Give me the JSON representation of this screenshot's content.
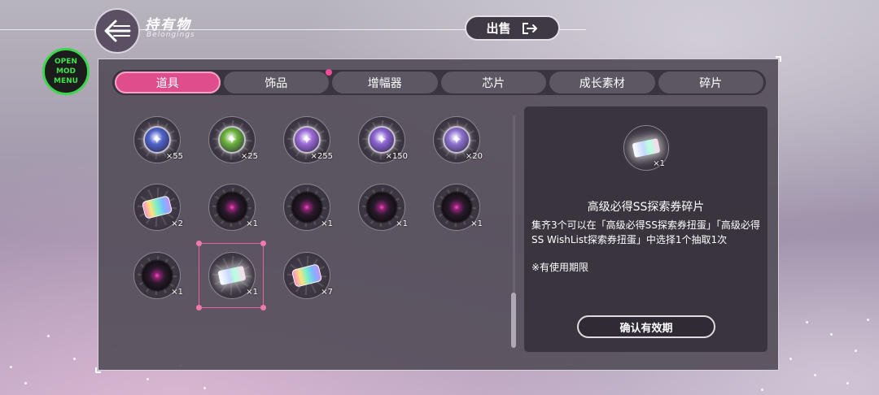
{
  "header": {
    "title": "持有物",
    "subtitle": "Belongings",
    "sell_label": "出售"
  },
  "mod_menu": {
    "line1": "OPEN",
    "line2": "MOD MENU"
  },
  "tabs": [
    {
      "label": "道具",
      "active": true
    },
    {
      "label": "饰品",
      "active": false,
      "has_notification": true
    },
    {
      "label": "增幅器",
      "active": false
    },
    {
      "label": "芯片",
      "active": false
    },
    {
      "label": "成长素材",
      "active": false
    },
    {
      "label": "碎片",
      "active": false
    }
  ],
  "items": [
    {
      "icon": "blue-gem-icon",
      "count": "×55",
      "color": "#4e63c9"
    },
    {
      "icon": "green-gem-icon",
      "count": "×25",
      "color": "#69b13a"
    },
    {
      "icon": "purple-gem-icon",
      "count": "×255",
      "color": "#9b6ad7"
    },
    {
      "icon": "violet-gem-icon",
      "count": "×150",
      "color": "#8a63d1"
    },
    {
      "icon": "lilac-gem-icon",
      "count": "×20",
      "color": "#8e72cf"
    },
    {
      "icon": "rainbow-puzzle-icon",
      "count": "×2"
    },
    {
      "icon": "shadow-orb-icon",
      "count": "×1"
    },
    {
      "icon": "shadow-orb-icon",
      "count": "×1"
    },
    {
      "icon": "shadow-orb-icon",
      "count": "×1"
    },
    {
      "icon": "shadow-orb-icon",
      "count": "×1"
    },
    {
      "icon": "shadow-orb-icon",
      "count": "×1"
    },
    {
      "icon": "ticket-fragment-icon",
      "count": "×1",
      "selected": true
    },
    {
      "icon": "rainbow-puzzle-icon",
      "count": "×7"
    }
  ],
  "detail": {
    "icon": "ticket-fragment-icon",
    "count": "×1",
    "title": "高级必得SS探索券碎片",
    "description": "集齐3个可以在「高级必得SS探索券扭蛋」「高级必得SS WishList探索券扭蛋」中选择1个抽取1次",
    "note": "※有使用期限",
    "confirm_label": "确认有效期"
  },
  "colors": {
    "accent": "#e04d8d",
    "panel": "#554e5a",
    "mod_menu_green": "#3bd64a"
  }
}
